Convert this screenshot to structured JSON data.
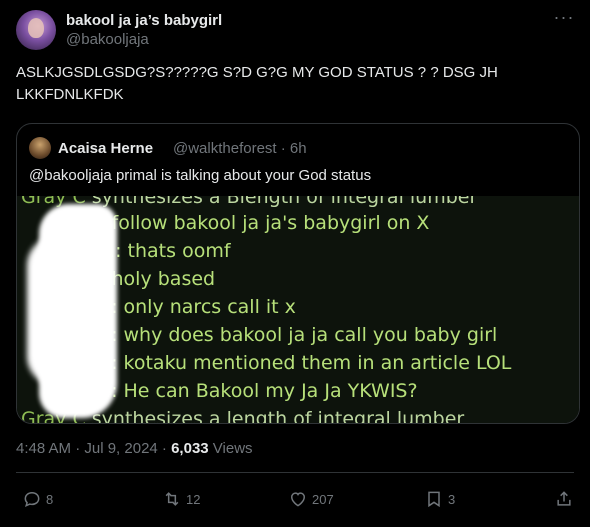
{
  "author": {
    "name": "bakool ja ja’s babygirl",
    "handle": "@bakooljaja"
  },
  "more_label": "···",
  "tweet_text": "ASLKJGSDLGSDG?S?????G S?D G?G MY GOD STATUS ? ? DSG JH LKKFDNLKFDK",
  "quoted": {
    "name": "Acaisa Herne",
    "handle": "@walktheforest · 6h",
    "text": "@bakooljaja primal is talking about your God status",
    "chat_lines": [
      {
        "prefix": "Gray C",
        "text": " synthesizes a Blength of integral lumber"
      },
      {
        "prefix": "",
        "text": "..: follow bakool ja ja's babygirl on X"
      },
      {
        "prefix": "",
        "text": "S.: thats oomf"
      },
      {
        "prefix": "",
        "text": "..: holy based"
      },
      {
        "prefix": "",
        "text": "..: only narcs call it x"
      },
      {
        "prefix": "",
        "text": "..: why does bakool ja ja call you baby girl"
      },
      {
        "prefix": "",
        "text": "..: kotaku mentioned them in an article LOL"
      },
      {
        "prefix": "",
        "text": "..: He can Bakool my Ja Ja YKWIS?"
      },
      {
        "prefix": "Gray C",
        "text": " synthesizes a  length of integral lumber"
      }
    ]
  },
  "timestamp": "4:48 AM · Jul 9, 2024 · ",
  "views_count": "6,033",
  "views_label": " Views",
  "actions": {
    "replies": "8",
    "reposts": "12",
    "likes": "207",
    "bookmarks": "3"
  },
  "icons": [
    "reply-icon",
    "repost-icon",
    "like-icon",
    "bookmark-icon",
    "share-icon"
  ],
  "colors": {
    "background": "#000000",
    "text": "#e7e9ea",
    "muted": "#71767b",
    "border": "#2f3336",
    "chat_green": "#b7e07a"
  }
}
